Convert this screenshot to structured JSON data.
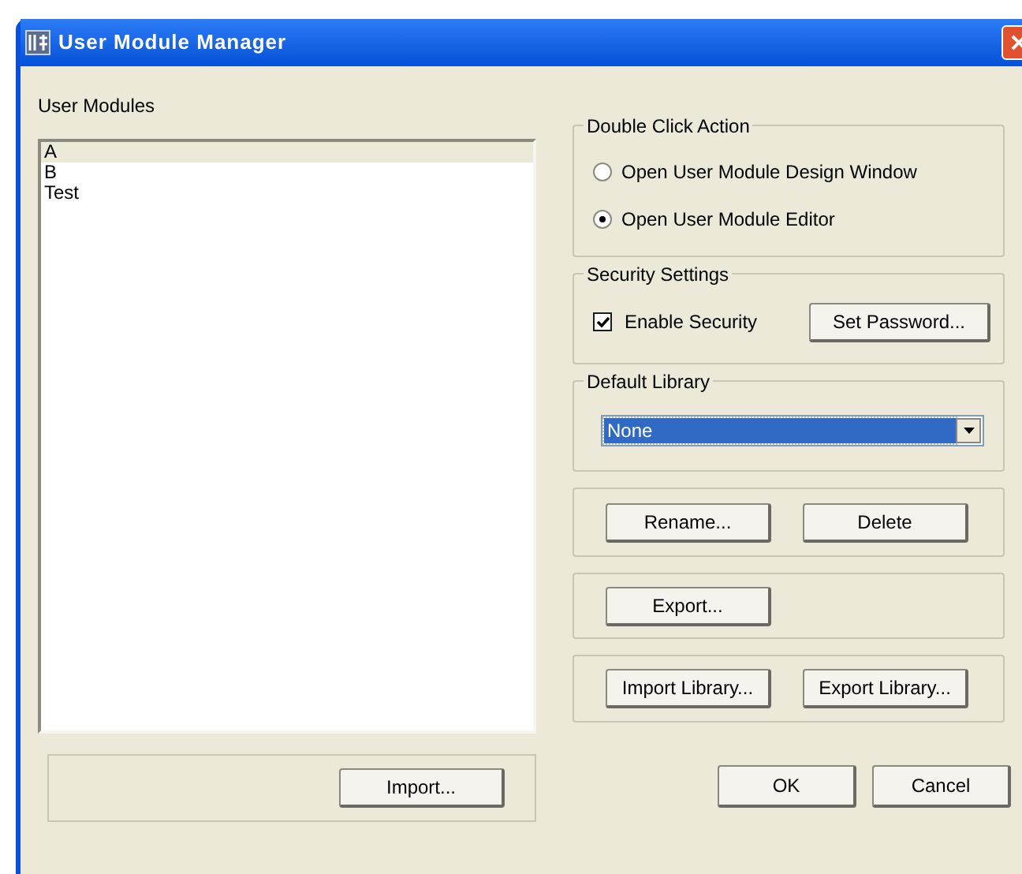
{
  "window": {
    "title": "User Module Manager"
  },
  "user_modules": {
    "label": "User Modules",
    "items": [
      {
        "name": "A",
        "selected": true
      },
      {
        "name": "B",
        "selected": false
      },
      {
        "name": "Test",
        "selected": false
      }
    ],
    "import_button": "Import..."
  },
  "double_click_action": {
    "title": "Double Click Action",
    "options": [
      {
        "label": "Open User Module Design Window",
        "selected": false
      },
      {
        "label": "Open User Module Editor",
        "selected": true
      }
    ]
  },
  "security_settings": {
    "title": "Security Settings",
    "enable_security": {
      "label": "Enable Security",
      "checked": true
    },
    "set_password_button": "Set Password..."
  },
  "default_library": {
    "title": "Default Library",
    "value": "None"
  },
  "edit_buttons": [
    "Rename...",
    "Delete"
  ],
  "export_buttons": [
    "Export..."
  ],
  "library_buttons": [
    "Import Library...",
    "Export Library..."
  ],
  "dialog_buttons": [
    "OK",
    "Cancel"
  ]
}
